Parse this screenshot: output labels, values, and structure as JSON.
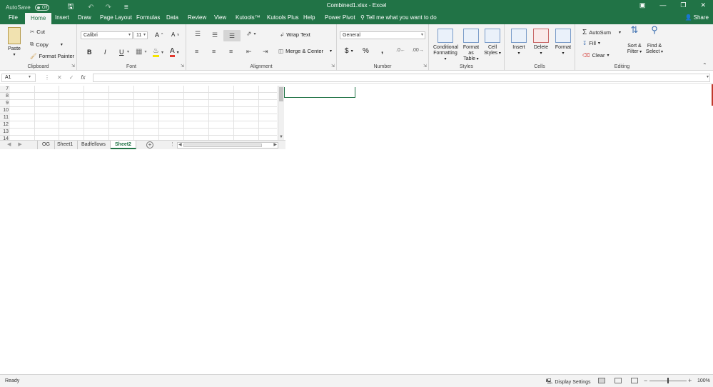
{
  "titlebar": {
    "autosave_label": "AutoSave",
    "autosave_state": "Off",
    "document_title": "Combined1.xlsx  -  Excel"
  },
  "tabs": [
    "File",
    "Home",
    "Insert",
    "Draw",
    "Page Layout",
    "Formulas",
    "Data",
    "Review",
    "View",
    "Kutools™",
    "Kutools Plus",
    "Help",
    "Power Pivot"
  ],
  "active_tab": "Home",
  "tell_me": "Tell me what you want to do",
  "share_label": "Share",
  "ribbon": {
    "clipboard": {
      "label": "Clipboard",
      "paste": "Paste",
      "cut": "Cut",
      "copy": "Copy",
      "format_painter": "Format Painter"
    },
    "font": {
      "label": "Font",
      "font_name": "Calibri",
      "font_size": "11",
      "bold": "B",
      "italic": "I",
      "underline": "U"
    },
    "alignment": {
      "label": "Alignment",
      "wrap_text": "Wrap Text",
      "merge_center": "Merge & Center"
    },
    "number": {
      "label": "Number",
      "format": "General",
      "currency": "$",
      "percent": "%",
      "comma": ","
    },
    "styles": {
      "label": "Styles",
      "conditional_1": "Conditional",
      "conditional_2": "Formatting",
      "format_table_1": "Format as",
      "format_table_2": "Table",
      "cell_styles_1": "Cell",
      "cell_styles_2": "Styles"
    },
    "cells": {
      "label": "Cells",
      "insert": "Insert",
      "delete": "Delete",
      "format": "Format"
    },
    "editing": {
      "label": "Editing",
      "autosum": "AutoSum",
      "fill": "Fill",
      "clear": "Clear",
      "sort_1": "Sort &",
      "sort_2": "Filter",
      "find_1": "Find &",
      "find_2": "Select"
    }
  },
  "formula_bar": {
    "name_box": "A1",
    "fx": "fx",
    "value": ""
  },
  "rows": [
    "7",
    "8",
    "9",
    "10",
    "11",
    "12",
    "13",
    "14"
  ],
  "sheets": [
    "OG",
    "Sheet1",
    "Badfellows",
    "Sheet2"
  ],
  "active_sheet": "Sheet2",
  "status": {
    "ready": "Ready",
    "display_settings": "Display Settings",
    "zoom": "100%"
  },
  "colors": {
    "excel_green": "#217346",
    "ribbon_bg": "#f3f3f3",
    "grid_line": "#e1e1e1"
  }
}
